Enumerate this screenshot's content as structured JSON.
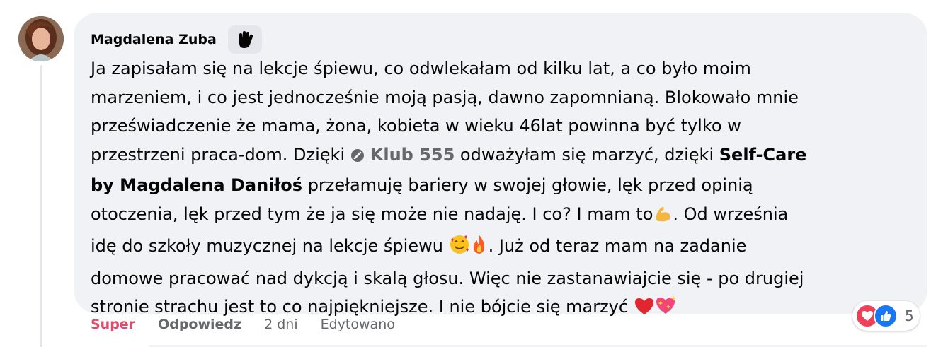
{
  "comment": {
    "author": "Magdalena Zuba",
    "author_badge_icon": "raised-hand-icon",
    "lines": [
      {
        "text": "Ja zapisałam się na lekcje śpiewu, co odwlekałam od kilku lat, a co było moim"
      },
      {
        "text": "marzeniem, i co jest jednocześnie moją pasją, dawno zapomnianą. Blokowało mnie"
      },
      {
        "text": "przeświadczenie że mama, żona, kobieta w wieku 46lat powinna być tylko w"
      }
    ],
    "line4_pre": "przestrzeni praca-dom. Dzięki ",
    "group_link": "Klub 555",
    "line4_post": " odważyłam się marzyć, dzięki ",
    "line4_bold": "Self-Care",
    "line5_bold": "by Magdalena Daniłoś",
    "line5_post": " przełamuję bariery w swojej głowie, lęk przed opinią",
    "line6_pre": "otoczenia, lęk przed tym że ja się może nie nadaję. I co? I mam to",
    "line6_post": ". Od września",
    "line7_pre": "idę do szkoły muzycznej na lekcje śpiewu ",
    "line7_post": ". Już od teraz mam na zadanie",
    "line8": "domowe pracować nad dykcją i skalą głosu. Więc nie zastanawiajcie się - po drugiej",
    "line9": "stronie strachu jest to co najpiękniejsze. I nie bójcie się marzyć ",
    "emojis": [
      "flexed-biceps-icon",
      "smiling-face-with-hearts-icon",
      "fire-icon",
      "red-heart-icon",
      "sparkling-heart-icon"
    ]
  },
  "actions": {
    "super": "Super",
    "reply": "Odpowiedz",
    "time": "2 dni",
    "edited": "Edytowano"
  },
  "reactions": {
    "types": [
      "love",
      "like"
    ],
    "count": "5"
  },
  "colors": {
    "bubble": "#f0f2f5",
    "super": "#e24b6b",
    "secondary_text": "#65676b",
    "like": "#1877f2",
    "love": "#f33e58"
  }
}
